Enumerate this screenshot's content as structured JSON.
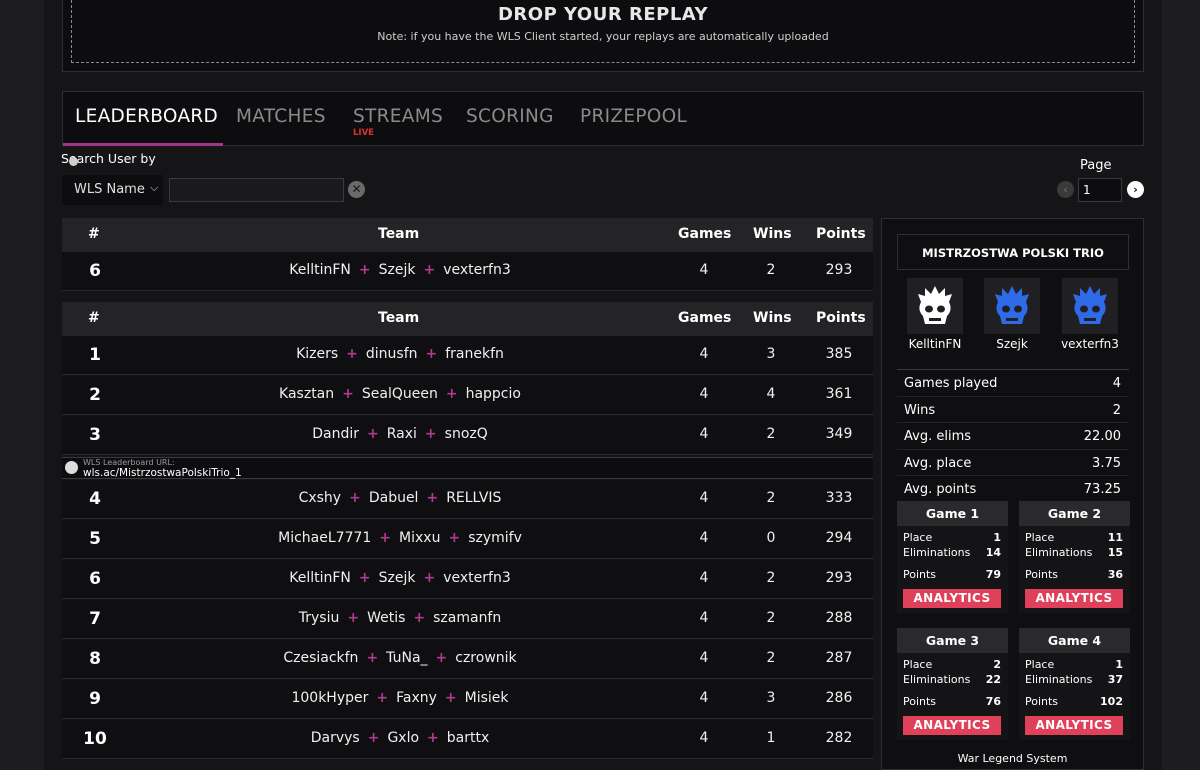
{
  "dropzone": {
    "title": "DROP YOUR REPLAY",
    "note": "Note: if you have the WLS Client started, your replays are automatically uploaded"
  },
  "tabs": [
    {
      "label": "LEADERBOARD",
      "active": true
    },
    {
      "label": "MATCHES",
      "active": false
    },
    {
      "label": "STREAMS",
      "active": false,
      "badge": "LIVE"
    },
    {
      "label": "SCORING",
      "active": false
    },
    {
      "label": "PRIZEPOOL",
      "active": false
    }
  ],
  "search": {
    "label": "Search User by",
    "mode_selected": "WLS Name",
    "value": ""
  },
  "pagination": {
    "label": "Page",
    "current": "1"
  },
  "table_headers": {
    "rank": "#",
    "team": "Team",
    "games": "Games",
    "wins": "Wins",
    "points": "Points"
  },
  "my_team": {
    "rank": "6",
    "players": [
      "KelltinFN",
      "Szejk",
      "vexterfn3"
    ],
    "games": "4",
    "wins": "2",
    "points": "293"
  },
  "leaderboard_url": {
    "label": "WLS Leaderboard URL:",
    "url": "wls.ac/MistrzostwaPolskiTrio_1"
  },
  "rows": [
    {
      "rank": "1",
      "players": [
        "Kizers",
        "dinusfn",
        "franekfn"
      ],
      "games": "4",
      "wins": "3",
      "points": "385"
    },
    {
      "rank": "2",
      "players": [
        "Kasztan",
        "SealQueen",
        "happcio"
      ],
      "games": "4",
      "wins": "4",
      "points": "361"
    },
    {
      "rank": "3",
      "players": [
        "Dandir",
        "Raxi",
        "snozQ"
      ],
      "games": "4",
      "wins": "2",
      "points": "349"
    },
    {
      "rank": "4",
      "players": [
        "Cxshy",
        "Dabuel",
        "RELLVIS"
      ],
      "games": "4",
      "wins": "2",
      "points": "333"
    },
    {
      "rank": "5",
      "players": [
        "MichaeL7771",
        "Mixxu",
        "szymifv"
      ],
      "games": "4",
      "wins": "0",
      "points": "294"
    },
    {
      "rank": "6",
      "players": [
        "KelltinFN",
        "Szejk",
        "vexterfn3"
      ],
      "games": "4",
      "wins": "2",
      "points": "293"
    },
    {
      "rank": "7",
      "players": [
        "Trysiu",
        "Wetis",
        "szamanfn"
      ],
      "games": "4",
      "wins": "2",
      "points": "288"
    },
    {
      "rank": "8",
      "players": [
        "Czesiackfn",
        "TuNa_",
        "czrownik"
      ],
      "games": "4",
      "wins": "2",
      "points": "287"
    },
    {
      "rank": "9",
      "players": [
        "100kHyper",
        "Faxny",
        "Misiek"
      ],
      "games": "4",
      "wins": "3",
      "points": "286"
    },
    {
      "rank": "10",
      "players": [
        "Darvys",
        "Gxlo",
        "barttx"
      ],
      "games": "4",
      "wins": "1",
      "points": "282"
    }
  ],
  "team_panel": {
    "title": "MISTRZOSTWA POLSKI TRIO",
    "players": [
      {
        "name": "KelltinFN",
        "avatar_color": "#ffffff"
      },
      {
        "name": "Szejk",
        "avatar_color": "#2f6be8"
      },
      {
        "name": "vexterfn3",
        "avatar_color": "#2f6be8"
      }
    ],
    "stats": [
      {
        "label": "Games played",
        "value": "4"
      },
      {
        "label": "Wins",
        "value": "2"
      },
      {
        "label": "Avg. elims",
        "value": "22.00"
      },
      {
        "label": "Avg. place",
        "value": "3.75"
      },
      {
        "label": "Avg. points",
        "value": "73.25"
      }
    ],
    "games": [
      {
        "title": "Game 1",
        "place_label": "Place",
        "place": "1",
        "elims_label": "Eliminations",
        "elims": "14",
        "points_label": "Points",
        "points": "79",
        "button": "ANALYTICS"
      },
      {
        "title": "Game 2",
        "place_label": "Place",
        "place": "11",
        "elims_label": "Eliminations",
        "elims": "15",
        "points_label": "Points",
        "points": "36",
        "button": "ANALYTICS"
      },
      {
        "title": "Game 3",
        "place_label": "Place",
        "place": "2",
        "elims_label": "Eliminations",
        "elims": "22",
        "points_label": "Points",
        "points": "76",
        "button": "ANALYTICS"
      },
      {
        "title": "Game 4",
        "place_label": "Place",
        "place": "1",
        "elims_label": "Eliminations",
        "elims": "37",
        "points_label": "Points",
        "points": "102",
        "button": "ANALYTICS"
      }
    ],
    "footer": "War Legend System"
  },
  "colors": {
    "accent": "#a0358a",
    "plus": "#b03a92",
    "live": "#e03030",
    "analytics": "#e0405a"
  }
}
